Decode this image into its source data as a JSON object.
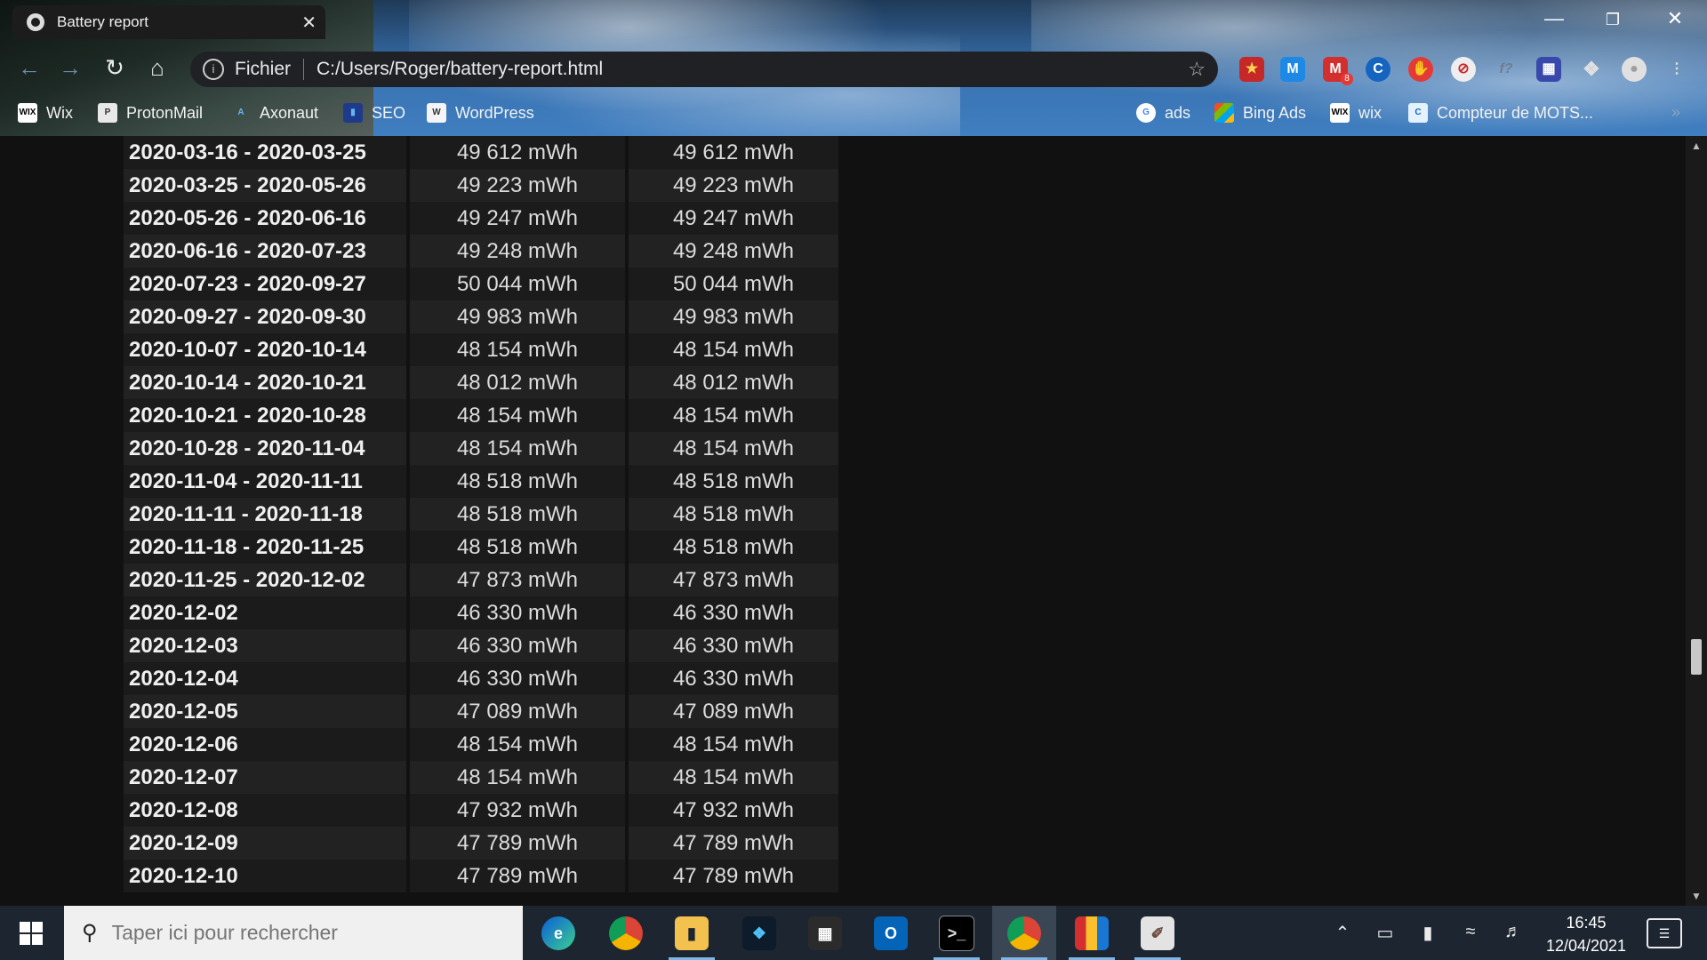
{
  "browser": {
    "tab_title": "Battery report",
    "tab_close": "✕",
    "scheme_label": "Fichier",
    "url": "C:/Users/Roger/battery-report.html",
    "mail_badge": "8",
    "bookmarks": [
      {
        "label": "Wix",
        "icon": "WIX"
      },
      {
        "label": "ProtonMail",
        "icon": "P"
      },
      {
        "label": "Axonaut",
        "icon": "A"
      },
      {
        "label": "SEO",
        "icon": "▮"
      },
      {
        "label": "WordPress",
        "icon": "W"
      },
      {
        "label": "ads",
        "icon": "G"
      },
      {
        "label": "Bing Ads",
        "icon": "■"
      },
      {
        "label": "wix",
        "icon": "WIX"
      },
      {
        "label": "Compteur de MOTS...",
        "icon": "C"
      }
    ]
  },
  "table": {
    "rows": [
      {
        "period": "2020-03-16 - 2020-03-25",
        "full_charge": "49 612 mWh",
        "design": "49 612 mWh"
      },
      {
        "period": "2020-03-25 - 2020-05-26",
        "full_charge": "49 223 mWh",
        "design": "49 223 mWh"
      },
      {
        "period": "2020-05-26 - 2020-06-16",
        "full_charge": "49 247 mWh",
        "design": "49 247 mWh"
      },
      {
        "period": "2020-06-16 - 2020-07-23",
        "full_charge": "49 248 mWh",
        "design": "49 248 mWh"
      },
      {
        "period": "2020-07-23 - 2020-09-27",
        "full_charge": "50 044 mWh",
        "design": "50 044 mWh"
      },
      {
        "period": "2020-09-27 - 2020-09-30",
        "full_charge": "49 983 mWh",
        "design": "49 983 mWh"
      },
      {
        "period": "2020-10-07 - 2020-10-14",
        "full_charge": "48 154 mWh",
        "design": "48 154 mWh"
      },
      {
        "period": "2020-10-14 - 2020-10-21",
        "full_charge": "48 012 mWh",
        "design": "48 012 mWh"
      },
      {
        "period": "2020-10-21 - 2020-10-28",
        "full_charge": "48 154 mWh",
        "design": "48 154 mWh"
      },
      {
        "period": "2020-10-28 - 2020-11-04",
        "full_charge": "48 154 mWh",
        "design": "48 154 mWh"
      },
      {
        "period": "2020-11-04 - 2020-11-11",
        "full_charge": "48 518 mWh",
        "design": "48 518 mWh"
      },
      {
        "period": "2020-11-11 - 2020-11-18",
        "full_charge": "48 518 mWh",
        "design": "48 518 mWh"
      },
      {
        "period": "2020-11-18 - 2020-11-25",
        "full_charge": "48 518 mWh",
        "design": "48 518 mWh"
      },
      {
        "period": "2020-11-25 - 2020-12-02",
        "full_charge": "47 873 mWh",
        "design": "47 873 mWh"
      },
      {
        "period": "2020-12-02",
        "full_charge": "46 330 mWh",
        "design": "46 330 mWh"
      },
      {
        "period": "2020-12-03",
        "full_charge": "46 330 mWh",
        "design": "46 330 mWh"
      },
      {
        "period": "2020-12-04",
        "full_charge": "46 330 mWh",
        "design": "46 330 mWh"
      },
      {
        "period": "2020-12-05",
        "full_charge": "47 089 mWh",
        "design": "47 089 mWh"
      },
      {
        "period": "2020-12-06",
        "full_charge": "48 154 mWh",
        "design": "48 154 mWh"
      },
      {
        "period": "2020-12-07",
        "full_charge": "48 154 mWh",
        "design": "48 154 mWh"
      },
      {
        "period": "2020-12-08",
        "full_charge": "47 932 mWh",
        "design": "47 932 mWh"
      },
      {
        "period": "2020-12-09",
        "full_charge": "47 789 mWh",
        "design": "47 789 mWh"
      },
      {
        "period": "2020-12-10",
        "full_charge": "47 789 mWh",
        "design": "47 789 mWh"
      }
    ]
  },
  "taskbar": {
    "search_placeholder": "Taper ici pour rechercher",
    "time": "16:45",
    "date": "12/04/2021",
    "apps": [
      "edge-icon",
      "chrome-icon",
      "file-explorer-icon",
      "app-blue-icon",
      "calculator-icon",
      "outlook-icon",
      "terminal-icon",
      "chrome-active-icon",
      "books-icon",
      "paint-icon"
    ]
  },
  "colors": {
    "accent": "#7fb6e6",
    "page_bg": "#111111",
    "row_bg": "#1b1b1b"
  }
}
